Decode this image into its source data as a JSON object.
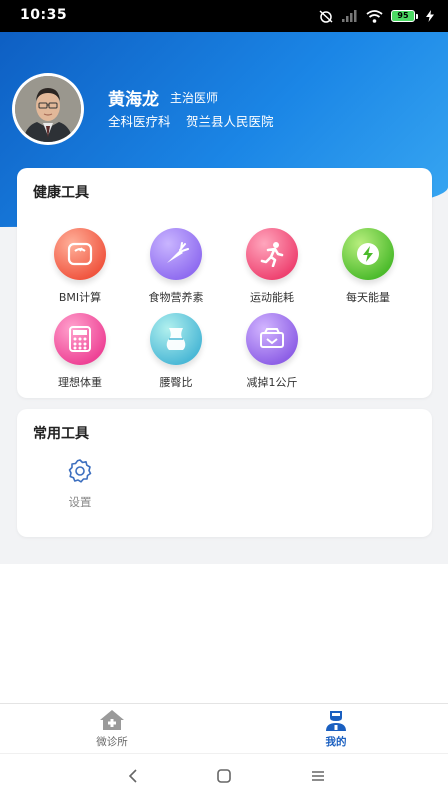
{
  "status": {
    "time": "10:35",
    "battery": "95"
  },
  "doctor": {
    "name": "黄海龙",
    "title": "主治医师",
    "department": "全科医疗科",
    "hospital": "贺兰县人民医院"
  },
  "health_tools": {
    "title": "健康工具",
    "items": [
      {
        "label": "BMI计算",
        "icon": "scale-icon",
        "color": "#f0553f"
      },
      {
        "label": "食物营养素",
        "icon": "carrot-icon",
        "color": "#8f6cf0"
      },
      {
        "label": "运动能耗",
        "icon": "runner-icon",
        "color": "#ee4270"
      },
      {
        "label": "每天能量",
        "icon": "lightning-icon",
        "color": "#4cbb2c"
      },
      {
        "label": "理想体重",
        "icon": "calculator-icon",
        "color": "#ee4295"
      },
      {
        "label": "腰臀比",
        "icon": "waist-icon",
        "color": "#4bb8d6"
      },
      {
        "label": "减掉1公斤",
        "icon": "weight-loss-icon",
        "color": "#8d5fe6"
      }
    ]
  },
  "common_tools": {
    "title": "常用工具",
    "items": [
      {
        "label": "设置",
        "icon": "gear-icon"
      }
    ]
  },
  "tab_bar": {
    "items": [
      {
        "label": "微诊所",
        "icon": "home-clinic-icon",
        "active": false
      },
      {
        "label": "我的",
        "icon": "doctor-profile-icon",
        "active": true
      }
    ],
    "active_color": "#1a5fc0"
  },
  "theme": {
    "header_blue": "#1677e0",
    "background": "#f2f3f5"
  }
}
